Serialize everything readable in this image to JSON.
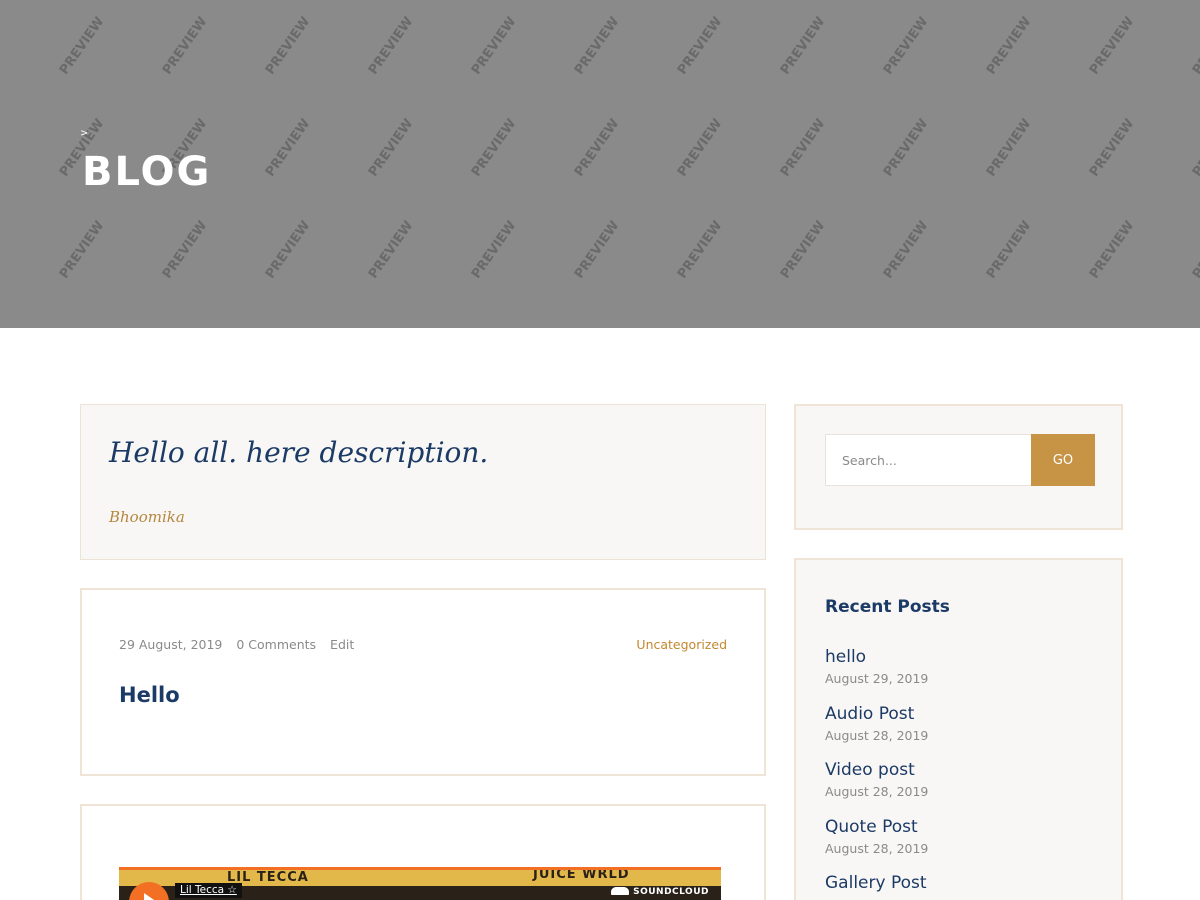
{
  "hero": {
    "crumb": ">",
    "title": "BLOG",
    "watermark": "PREVIEW",
    "background": "#8a8a8a"
  },
  "quote": {
    "text": "Hello all. here description.",
    "author": "Bhoomika"
  },
  "post": {
    "date": "29 August, 2019",
    "comments": "0 Comments",
    "edit": "Edit",
    "category": "Uncategorized",
    "title": "Hello"
  },
  "audio": {
    "artist_left": "LIL TECCA",
    "artist_right": "JUICE WRLD",
    "user": "Lil Tecca ☆",
    "brand": "SOUNDCLOUD",
    "play_icon": "play-icon"
  },
  "search": {
    "placeholder": "Search...",
    "button_label": "GO"
  },
  "recent_posts": {
    "title": "Recent Posts",
    "items": [
      {
        "label": "hello",
        "date": "August 29, 2019"
      },
      {
        "label": "Audio Post",
        "date": "August 28, 2019"
      },
      {
        "label": "Video post",
        "date": "August 28, 2019"
      },
      {
        "label": "Quote Post",
        "date": "August 28, 2019"
      },
      {
        "label": "Gallery Post",
        "date": ""
      }
    ]
  },
  "colors": {
    "navy": "#1b3a66",
    "gold": "#c79344",
    "soundcloud_orange": "#f26f23"
  }
}
